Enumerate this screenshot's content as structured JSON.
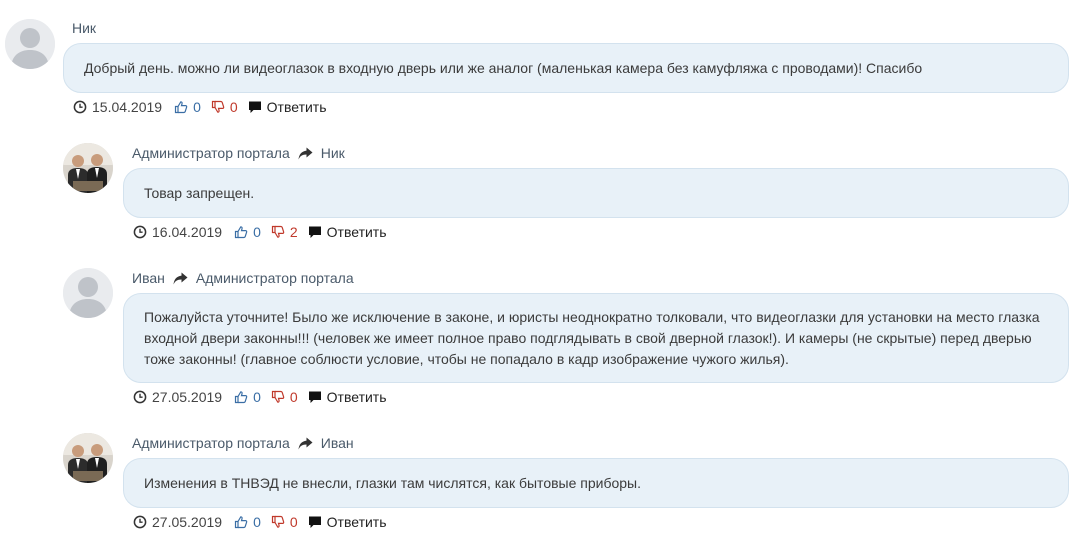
{
  "comments": [
    {
      "author": "Ник",
      "reply_to": "",
      "text": "Добрый день. можно ли видеоглазок в входную дверь или же аналог (маленькая камера без камуфляжа с проводами)! Спасибо",
      "date": "15.04.2019",
      "likes": "0",
      "dislikes": "0",
      "reply_label": "Ответить",
      "avatar": "default-user-avatar"
    },
    {
      "author": "Администратор портала",
      "reply_to": "Ник",
      "text": "Товар запрещен.",
      "date": "16.04.2019",
      "likes": "0",
      "dislikes": "2",
      "reply_label": "Ответить",
      "avatar": "admin-photo-avatar"
    },
    {
      "author": "Иван",
      "reply_to": "Администратор портала",
      "text": "Пожалуйста уточните! Было же исключение в законе, и юристы неоднократно толковали, что видеоглазки для установки на место глазка входной двери законны!!! (человек же имеет полное право подглядывать в свой дверной глазок!). И камеры (не скрытые) перед дверью тоже законны! (главное соблюсти условие, чтобы не попадало в кадр изображение чужого жилья).",
      "date": "27.05.2019",
      "likes": "0",
      "dislikes": "0",
      "reply_label": "Ответить",
      "avatar": "default-user-avatar"
    },
    {
      "author": "Администратор портала",
      "reply_to": "Иван",
      "text": "Изменения в ТНВЭД не внесли, глазки там числятся, как бытовые приборы.",
      "date": "27.05.2019",
      "likes": "0",
      "dislikes": "0",
      "reply_label": "Ответить",
      "avatar": "admin-photo-avatar"
    }
  ],
  "icons": {
    "date": "clock-icon",
    "like": "thumbs-up-icon",
    "dislike": "thumbs-down-icon",
    "reply": "speech-bubble-icon",
    "reply_arrow": "share-arrow-icon"
  },
  "colors": {
    "bubble_bg": "#e8f1f8",
    "like": "#3a6ea5",
    "dislike": "#c0392b"
  }
}
